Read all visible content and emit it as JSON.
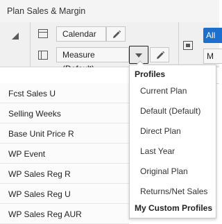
{
  "header": {
    "title": "Plan Sales & Margin"
  },
  "toolbar": {
    "calendar_label": "Calendar",
    "measure_label": "Measure (Default)",
    "all_label": "All",
    "m_label": "M"
  },
  "rows": [
    "Fcst Sales U",
    "Selling Weeks",
    "Base Unit Price R",
    "WP Event",
    "WP Sales Reg R",
    "WP Sales Reg U",
    "WP Sales Reg AUR"
  ],
  "popup": {
    "profiles_header": "Profiles",
    "items": [
      "Current Plan",
      "Default (Default)",
      "Direct Plan",
      "Last Year",
      "Original Plan",
      "Returns/Net Sales"
    ],
    "custom_header": "My Custom Profiles"
  },
  "colors": {
    "accent": "#1a6fcf",
    "toolbar_bg": "#f0f0f0"
  },
  "icons": [
    "pencil-icon",
    "chevron-down-icon",
    "layout-rows-icon",
    "layout-columns-icon",
    "layout-box-icon"
  ]
}
